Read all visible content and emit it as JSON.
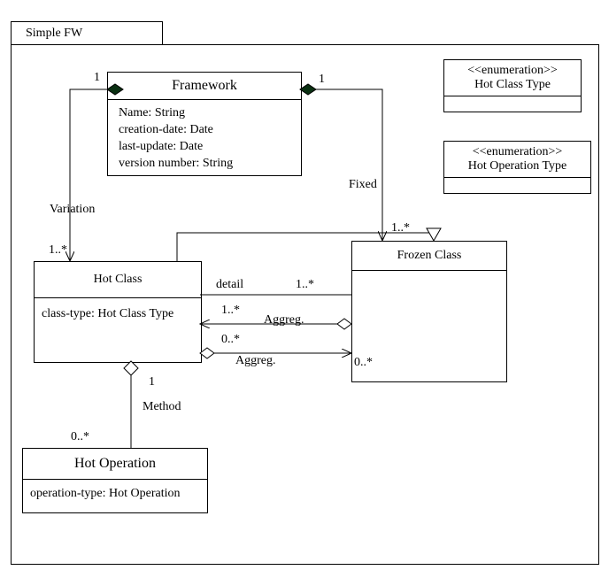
{
  "package": {
    "name": "Simple FW"
  },
  "framework": {
    "title": "Framework",
    "attrs": [
      "Name: String",
      "creation-date: Date",
      "last-update: Date",
      "version number: String"
    ]
  },
  "hotClass": {
    "title": "Hot Class",
    "attr": "class-type: Hot Class Type"
  },
  "frozenClass": {
    "title": "Frozen Class"
  },
  "hotOperation": {
    "title": "Hot Operation",
    "attr": "operation-type: Hot Operation"
  },
  "enum1": {
    "stereo": "<<enumeration>>",
    "title": "Hot Class Type"
  },
  "enum2": {
    "stereo": "<<enumeration>>",
    "title": "Hot Operation Type"
  },
  "labels": {
    "variation": "Variation",
    "fixed": "Fixed",
    "method": "Method",
    "detail": "detail",
    "aggreg1": "Aggreg.",
    "aggreg2": "Aggreg.",
    "one_a": "1",
    "one_b": "1",
    "one_c": "1",
    "m_var": "1..*",
    "m_fixed": "1..*",
    "m_detail": "1..*",
    "m_agg1a": "1..*",
    "m_agg1b": "0..*",
    "m_agg2b": "0..*",
    "m_method": "0..*"
  },
  "chart_data": {
    "type": "table",
    "title": "UML Class Diagram — Simple FW",
    "classes": [
      {
        "name": "Framework",
        "attributes": [
          "Name: String",
          "creation-date: Date",
          "last-update: Date",
          "version number: String"
        ]
      },
      {
        "name": "Hot Class",
        "attributes": [
          "class-type: Hot Class Type"
        ]
      },
      {
        "name": "Frozen Class",
        "attributes": []
      },
      {
        "name": "Hot Operation",
        "attributes": [
          "operation-type: Hot Operation"
        ]
      },
      {
        "name": "Hot Class Type",
        "stereotype": "enumeration"
      },
      {
        "name": "Hot Operation Type",
        "stereotype": "enumeration"
      }
    ],
    "relationships": [
      {
        "from": "Framework",
        "to": "Hot Class",
        "type": "composition",
        "name": "Variation",
        "from_mult": "1",
        "to_mult": "1..*"
      },
      {
        "from": "Framework",
        "to": "Frozen Class",
        "type": "composition",
        "name": "Fixed",
        "from_mult": "1",
        "to_mult": "1..*"
      },
      {
        "from": "Hot Class",
        "to": "Frozen Class",
        "type": "generalization"
      },
      {
        "from": "Hot Class",
        "to": "Frozen Class",
        "type": "association",
        "name": "detail",
        "to_mult": "1..*"
      },
      {
        "from": "Frozen Class",
        "to": "Hot Class",
        "type": "aggregation",
        "name": "Aggreg.",
        "to_mult": "1..*"
      },
      {
        "from": "Hot Class",
        "to": "Frozen Class",
        "type": "aggregation",
        "name": "Aggreg.",
        "from_mult": "0..*",
        "to_mult": "0..*"
      },
      {
        "from": "Hot Class",
        "to": "Hot Operation",
        "type": "aggregation",
        "name": "Method",
        "from_mult": "1",
        "to_mult": "0..*"
      }
    ]
  }
}
